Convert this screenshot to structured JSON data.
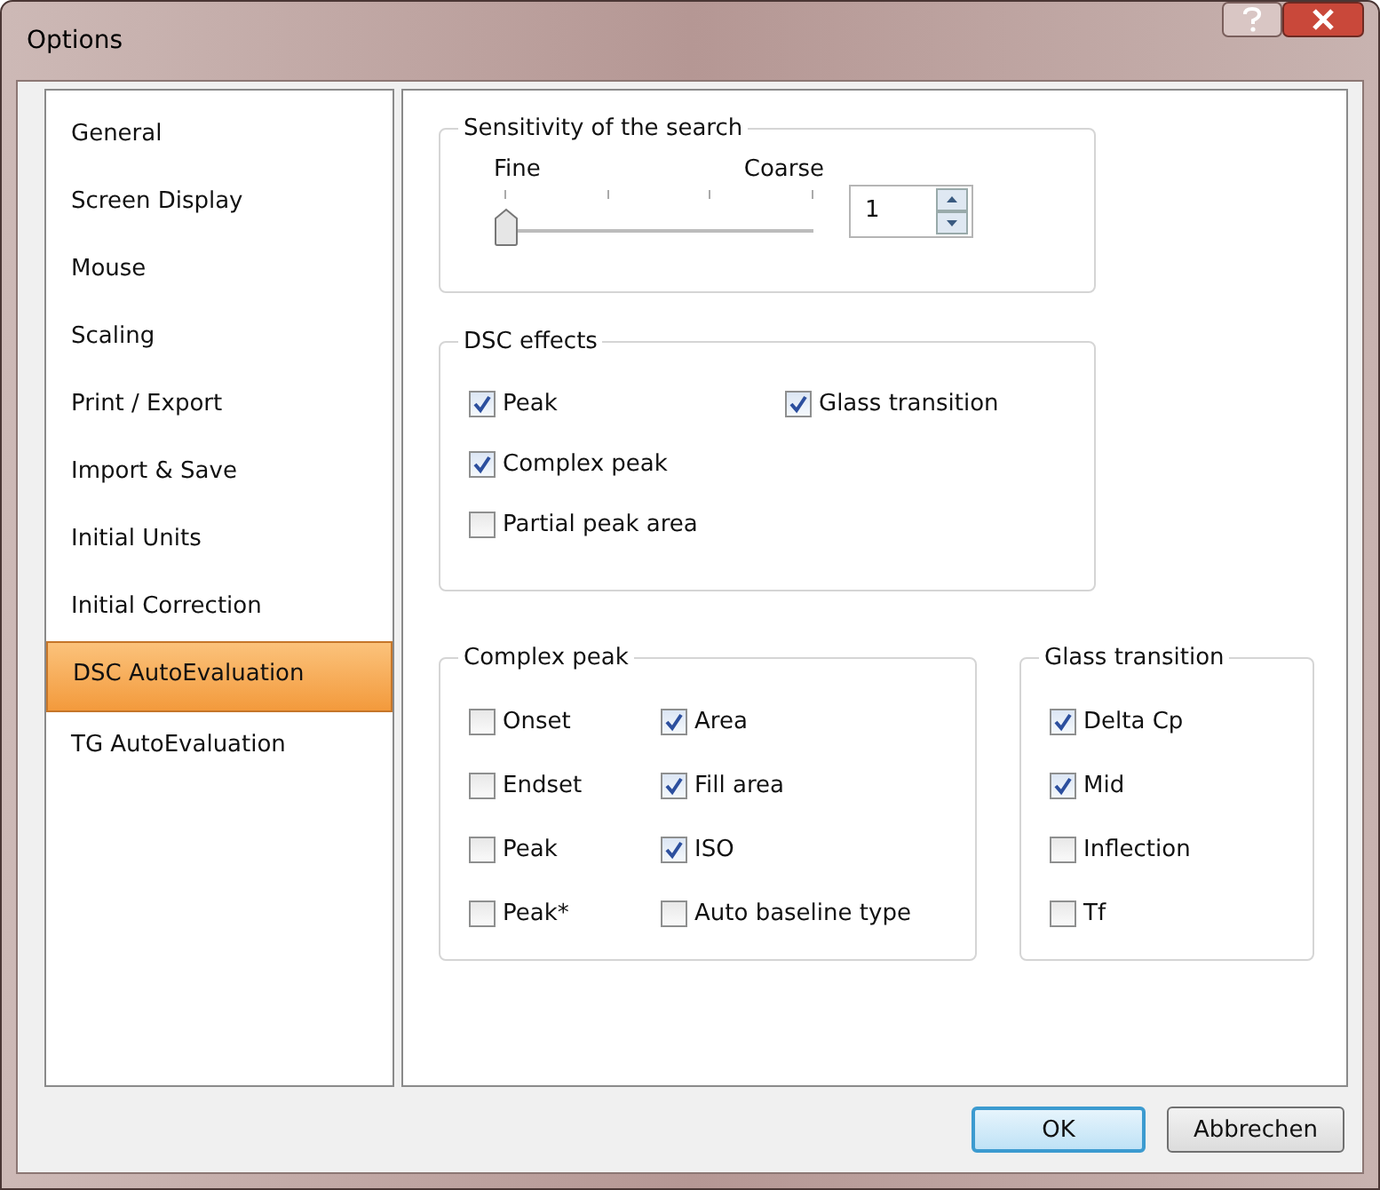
{
  "window": {
    "title": "Options"
  },
  "sidebar": {
    "items": [
      {
        "label": "General",
        "selected": false
      },
      {
        "label": "Screen Display",
        "selected": false
      },
      {
        "label": "Mouse",
        "selected": false
      },
      {
        "label": "Scaling",
        "selected": false
      },
      {
        "label": "Print / Export",
        "selected": false
      },
      {
        "label": "Import & Save",
        "selected": false
      },
      {
        "label": "Initial Units",
        "selected": false
      },
      {
        "label": "Initial Correction",
        "selected": false
      },
      {
        "label": "DSC AutoEvaluation",
        "selected": true
      },
      {
        "label": "TG AutoEvaluation",
        "selected": false
      }
    ]
  },
  "sensitivity": {
    "title": "Sensitivity of the search",
    "min_label": "Fine",
    "max_label": "Coarse",
    "level": 0,
    "value": "1"
  },
  "dsc_effects": {
    "title": "DSC effects",
    "items": [
      {
        "label": "Peak",
        "checked": true
      },
      {
        "label": "Complex peak",
        "checked": true
      },
      {
        "label": "Partial peak area",
        "checked": false
      },
      {
        "label": "Glass transition",
        "checked": true
      }
    ]
  },
  "complex_peak": {
    "title": "Complex peak",
    "items": [
      {
        "label": "Onset",
        "checked": false
      },
      {
        "label": "Endset",
        "checked": false
      },
      {
        "label": "Peak",
        "checked": false
      },
      {
        "label": "Peak*",
        "checked": false
      },
      {
        "label": "Area",
        "checked": true
      },
      {
        "label": "Fill area",
        "checked": true
      },
      {
        "label": "ISO",
        "checked": true
      },
      {
        "label": "Auto baseline type",
        "checked": false
      }
    ]
  },
  "glass_transition": {
    "title": "Glass transition",
    "items": [
      {
        "label": "Delta Cp",
        "checked": true
      },
      {
        "label": "Mid",
        "checked": true
      },
      {
        "label": "Inflection",
        "checked": false
      },
      {
        "label": "Tf",
        "checked": false
      }
    ]
  },
  "buttons": [
    {
      "label": "OK",
      "default": true
    },
    {
      "label": "Abbrechen",
      "default": false
    }
  ]
}
